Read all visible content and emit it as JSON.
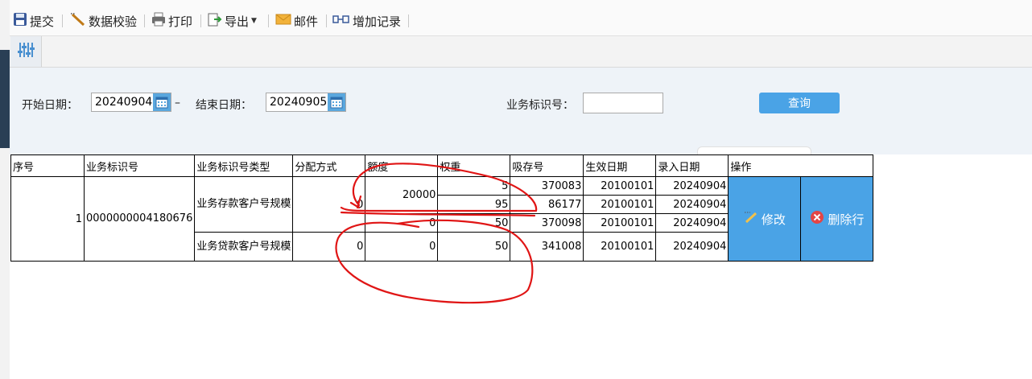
{
  "toolbar": {
    "items": [
      {
        "label": "提交",
        "icon": "save-icon"
      },
      {
        "label": "数据校验",
        "icon": "wand-icon"
      },
      {
        "label": "打印",
        "icon": "printer-icon"
      },
      {
        "label": "导出",
        "icon": "export-icon"
      },
      {
        "label": "邮件",
        "icon": "mail-icon"
      },
      {
        "label": "增加记录",
        "icon": "add-record-icon"
      }
    ]
  },
  "filter": {
    "start_label": "开始日期：",
    "start_value": "20240904",
    "dash": "–",
    "end_label": "结束日期：",
    "end_value": "20240905",
    "bizid_label": "业务标识号：",
    "bizid_value": "",
    "query_label": "查询"
  },
  "table": {
    "headers": [
      "序号",
      "业务标识号",
      "业务标识号类型",
      "分配方式",
      "额度",
      "权重",
      "吸存号",
      "生效日期",
      "录入日期",
      "操作"
    ],
    "record": {
      "seq": "1",
      "bizid": "0000000004180676",
      "groups": [
        {
          "type": "业务存款客户号规模",
          "alloc": "0",
          "rows": [
            {
              "weight": "5",
              "deposit": "370083",
              "eff": "20100101",
              "entry": "20240904"
            },
            {
              "weight": "95",
              "deposit": "86177",
              "eff": "20100101",
              "entry": "20240904"
            },
            {
              "weight": "50",
              "deposit": "370098",
              "eff": "20100101",
              "entry": "20240904"
            }
          ],
          "amounts": [
            "20000",
            "0"
          ]
        },
        {
          "type": "业务贷款客户号规模",
          "alloc": "0",
          "amount": "0",
          "weight": "50",
          "deposit": "341008",
          "eff": "20100101",
          "entry": "20240904"
        }
      ]
    },
    "actions": {
      "edit": "修改",
      "delete": "删除行"
    }
  },
  "colors": {
    "accent": "#4aa3e6",
    "annotation": "#e01515",
    "filter_bg": "#eef3f8"
  }
}
